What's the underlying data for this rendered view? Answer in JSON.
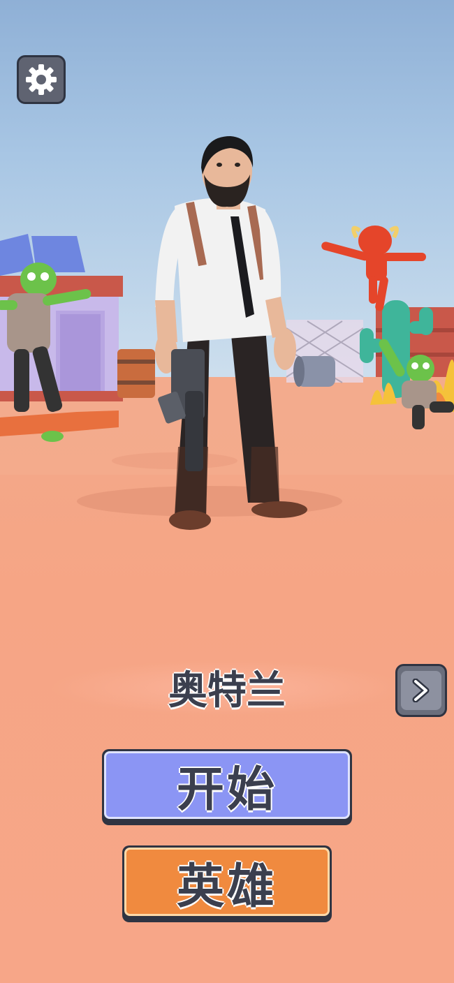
{
  "hero": {
    "name": "奥特兰"
  },
  "buttons": {
    "start_label": "开始",
    "heroes_label": "英雄"
  },
  "icons": {
    "settings": "gear-icon",
    "next": "chevron-right-icon"
  },
  "colors": {
    "start_button": "#8b95f4",
    "heroes_button": "#f08a3f",
    "ground": "#f6a585",
    "sky": "#a8c6e4"
  }
}
